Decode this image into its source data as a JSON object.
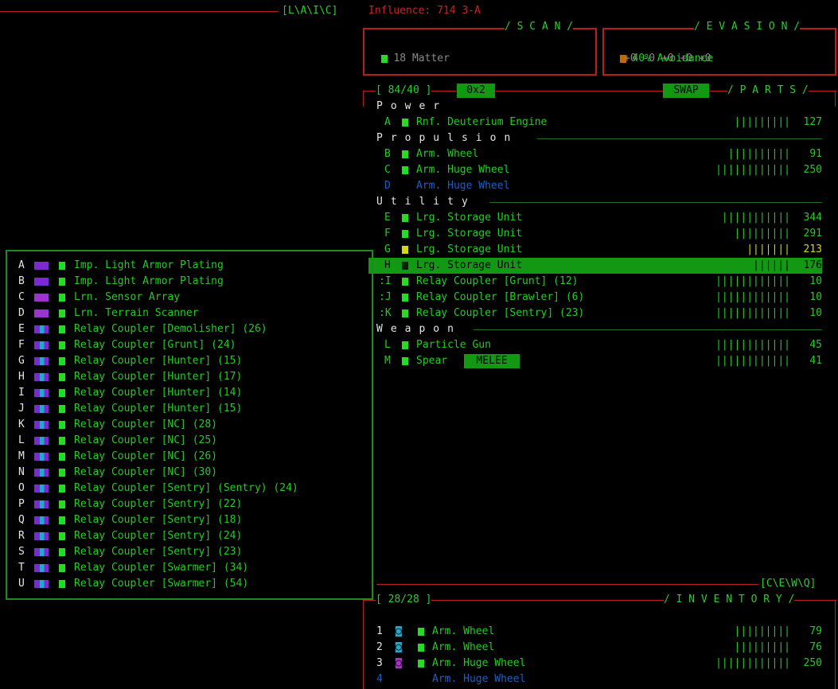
{
  "top": {
    "tag": "[L\\A\\I\\C]",
    "influence": "Influence: 714 3-A"
  },
  "scan": {
    "title": "/ S C A N /",
    "line": "18 Matter"
  },
  "evasion": {
    "title": "/ E V A S I O N /",
    "line1": "40% Avoidance",
    "line2": "+0 -0 +0 +0 +0"
  },
  "parts": {
    "capacity": "[ 84/40 ]",
    "mode": "0x2",
    "swap": "SWAP",
    "title": "/ P A R T S /",
    "sections": {
      "power": "Power",
      "propulsion": "Propulsion",
      "utility": "Utility",
      "weapon": "Weapon"
    },
    "rows": [
      {
        "key": "A",
        "name": "Rnf. Deuterium Engine",
        "bars": "|||||||||",
        "val": "127"
      },
      {
        "key": "B",
        "name": "Arm. Wheel",
        "bars": "||||||||||",
        "val": "91"
      },
      {
        "key": "C",
        "name": "Arm. Huge Wheel",
        "bars": "||||||||||||",
        "val": "250"
      },
      {
        "key": "D",
        "name": "Arm. Huge Wheel",
        "bars": "",
        "val": ""
      },
      {
        "key": "E",
        "name": "Lrg. Storage Unit",
        "bars": "|||||||||||",
        "val": "344"
      },
      {
        "key": "F",
        "name": "Lrg. Storage Unit",
        "bars": "|||||||||",
        "val": "291"
      },
      {
        "key": "G",
        "name": "Lrg. Storage Unit",
        "bars": "|||||||",
        "val": "213"
      },
      {
        "key": "H",
        "name": "Lrg. Storage Unit",
        "bars": "||||||",
        "val": "176"
      },
      {
        "key": ":I",
        "name": "Relay Coupler [Grunt] (12)",
        "bars": "||||||||||||",
        "val": "10"
      },
      {
        "key": ":J",
        "name": "Relay Coupler [Brawler] (6)",
        "bars": "||||||||||||",
        "val": "10"
      },
      {
        "key": ":K",
        "name": "Relay Coupler [Sentry] (23)",
        "bars": "||||||||||||",
        "val": "10"
      },
      {
        "key": "L",
        "name": "Particle Gun",
        "bars": "||||||||||||",
        "val": "45"
      },
      {
        "key": "M",
        "name": "Spear",
        "bars": "||||||||||||",
        "val": "41",
        "tag": "MELEE"
      }
    ]
  },
  "popup": {
    "rows": [
      {
        "key": "A",
        "name": "Imp. Light Armor Plating"
      },
      {
        "key": "B",
        "name": "Imp. Light Armor Plating"
      },
      {
        "key": "C",
        "name": "Lrn. Sensor Array"
      },
      {
        "key": "D",
        "name": "Lrn. Terrain Scanner"
      },
      {
        "key": "E",
        "name": "Relay Coupler [Demolisher] (26)"
      },
      {
        "key": "F",
        "name": "Relay Coupler [Grunt] (24)"
      },
      {
        "key": "G",
        "name": "Relay Coupler [Hunter] (15)"
      },
      {
        "key": "H",
        "name": "Relay Coupler [Hunter] (17)"
      },
      {
        "key": "I",
        "name": "Relay Coupler [Hunter] (14)"
      },
      {
        "key": "J",
        "name": "Relay Coupler [Hunter] (15)"
      },
      {
        "key": "K",
        "name": "Relay Coupler [NC] (28)"
      },
      {
        "key": "L",
        "name": "Relay Coupler [NC] (25)"
      },
      {
        "key": "M",
        "name": "Relay Coupler [NC] (26)"
      },
      {
        "key": "N",
        "name": "Relay Coupler [NC] (30)"
      },
      {
        "key": "O",
        "name": "Relay Coupler [Sentry] (Sentry) (24)"
      },
      {
        "key": "P",
        "name": "Relay Coupler [Sentry] (22)"
      },
      {
        "key": "Q",
        "name": "Relay Coupler [Sentry] (18)"
      },
      {
        "key": "R",
        "name": "Relay Coupler [Sentry] (24)"
      },
      {
        "key": "S",
        "name": "Relay Coupler [Sentry] (23)"
      },
      {
        "key": "T",
        "name": "Relay Coupler [Swarmer] (34)"
      },
      {
        "key": "U",
        "name": "Relay Coupler [Swarmer] (54)"
      }
    ]
  },
  "inventory": {
    "tag": "[C\\E\\W\\Q]",
    "capacity": "[ 28/28 ]",
    "title": "/ I N V E N T O R Y /",
    "rows": [
      {
        "key": "1",
        "name": "Arm. Wheel",
        "bars": "|||||||||",
        "val": "79"
      },
      {
        "key": "2",
        "name": "Arm. Wheel",
        "bars": "|||||||||",
        "val": "76"
      },
      {
        "key": "3",
        "name": "Arm. Huge Wheel",
        "bars": "||||||||||||",
        "val": "250"
      },
      {
        "key": "4",
        "name": "Arm. Huge Wheel",
        "bars": "",
        "val": ""
      }
    ]
  },
  "colors": {
    "accent_red": "#b81e1e",
    "text_green": "#22cc22",
    "highlight_green": "#139813",
    "disabled_blue": "#1d5fc4"
  }
}
